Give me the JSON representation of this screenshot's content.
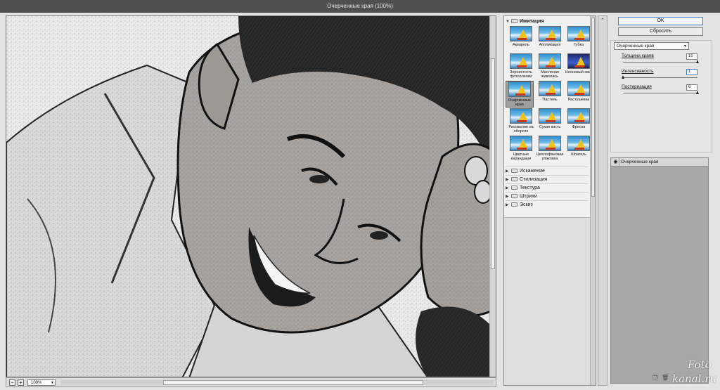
{
  "window": {
    "title": "Очерченные края (100%)"
  },
  "preview": {
    "zoom": "100%",
    "minus": "−",
    "plus": "+"
  },
  "gallery": {
    "open_category": "Имитация",
    "filters": [
      {
        "label": "Акварель"
      },
      {
        "label": "Аппликация"
      },
      {
        "label": "Губка"
      },
      {
        "label": "Зернистость фотопленки"
      },
      {
        "label": "Масляная живопись"
      },
      {
        "label": "Неоновый свет"
      },
      {
        "label": "Очерченные края",
        "selected": true
      },
      {
        "label": "Пастель"
      },
      {
        "label": "Растушевка"
      },
      {
        "label": "Рисование на обороте"
      },
      {
        "label": "Сухая кисть"
      },
      {
        "label": "Фреска"
      },
      {
        "label": "Цветные карандаши"
      },
      {
        "label": "Целлофановая упаковка"
      },
      {
        "label": "Шпатель"
      }
    ],
    "categories": [
      "Искажение",
      "Стилизация",
      "Текстура",
      "Штрихи",
      "Эскиз"
    ]
  },
  "buttons": {
    "ok": "OK",
    "reset": "Сбросить"
  },
  "settings": {
    "filter_select": "Очерченные края",
    "params": [
      {
        "name": "Толщина краев",
        "value": "10",
        "fraction": 1.0
      },
      {
        "name": "Интенсивность",
        "value": "1",
        "fraction": 0.0
      },
      {
        "name": "Постеризация",
        "value": "6",
        "fraction": 1.0
      }
    ]
  },
  "layers": [
    {
      "name": "Очерченные края"
    }
  ],
  "watermark": {
    "line1": "Foto",
    "line2": "kanal.ru"
  },
  "colors": {
    "ok_border": "#3c7fd1",
    "preview_bg": "#f3f3f3",
    "panel_bg": "#e3e3e3"
  },
  "icons": {
    "eye": "eye-icon",
    "new_layer": "new-layer-icon",
    "delete_layer": "trash-icon"
  }
}
